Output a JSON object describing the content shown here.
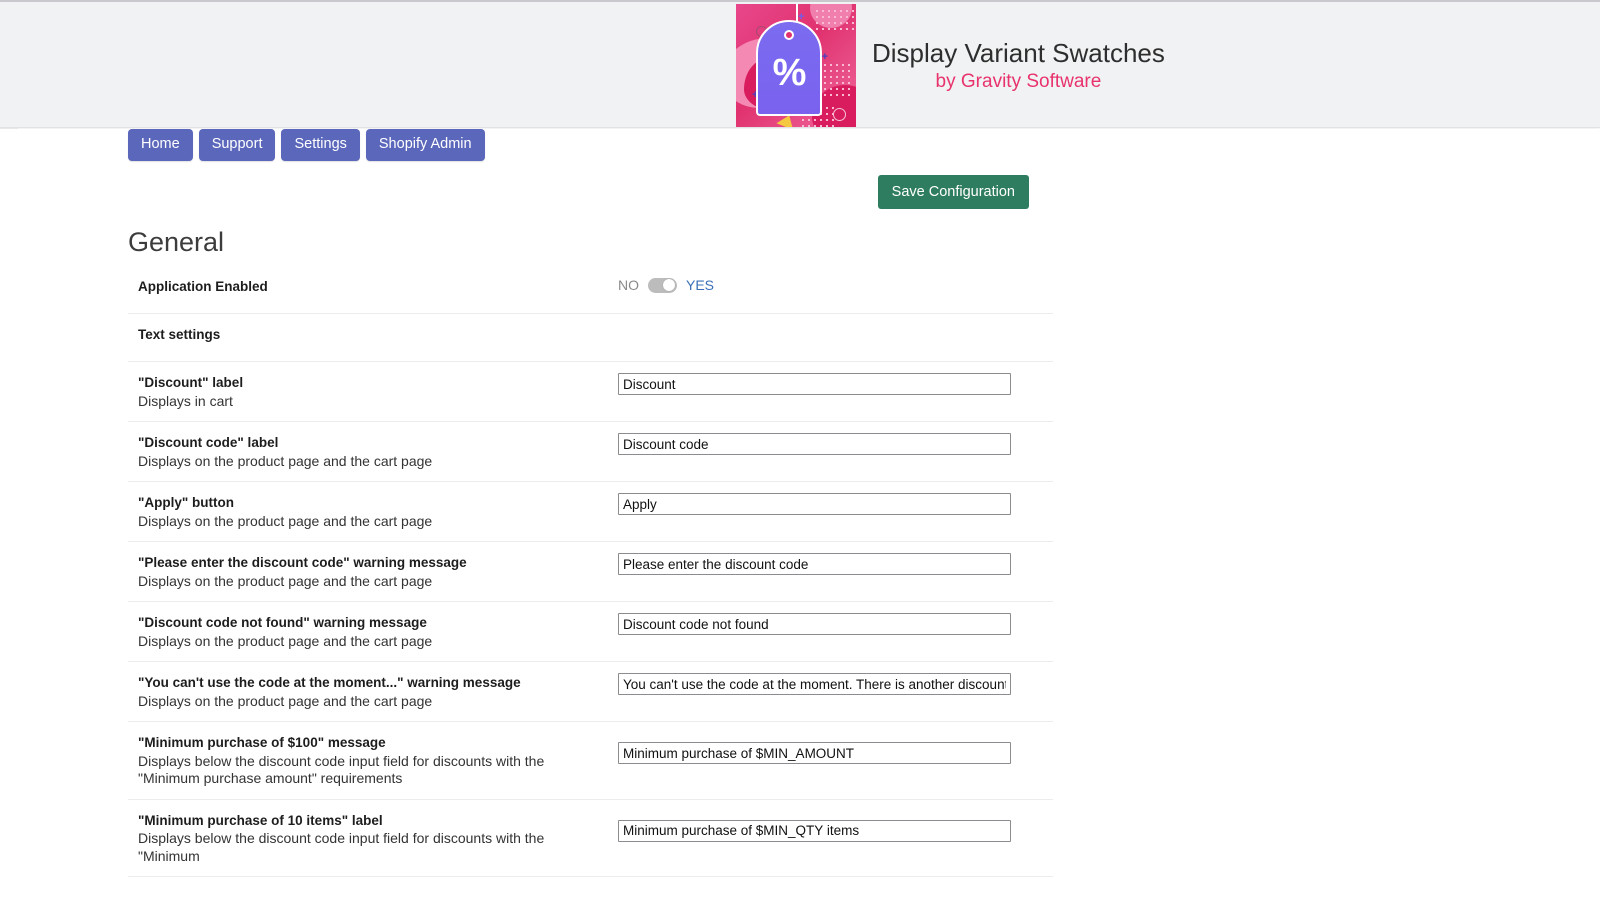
{
  "banner": {
    "app_title": "Display Variant Swatches",
    "byline": "by Gravity Software",
    "icon_name": "percent-tag-icon",
    "percent_symbol": "%",
    "accent_pink": "#e8336d",
    "background": "#f1f2f3"
  },
  "nav": {
    "items": [
      {
        "label": "Home",
        "name": "nav-home"
      },
      {
        "label": "Support",
        "name": "nav-support"
      },
      {
        "label": "Settings",
        "name": "nav-settings"
      },
      {
        "label": "Shopify Admin",
        "name": "nav-shopify-admin"
      }
    ],
    "color": "#5a67bb"
  },
  "toolbar": {
    "save_label": "Save Configuration",
    "save_color": "#2e7d61"
  },
  "main": {
    "section_title": "General",
    "rows": [
      {
        "title": "Application Enabled",
        "desc": "",
        "control": "toggle",
        "toggle_off": "NO",
        "toggle_on": "YES",
        "toggle_state": "on"
      },
      {
        "title": "Text settings",
        "desc": "",
        "control": "none"
      },
      {
        "title": "\"Discount\" label",
        "desc": "Displays in cart",
        "control": "input",
        "value": "Discount"
      },
      {
        "title": "\"Discount code\" label",
        "desc": "Displays on the product page and the cart page",
        "control": "input",
        "value": "Discount code"
      },
      {
        "title": "\"Apply\" button",
        "desc": "Displays on the product page and the cart page",
        "control": "input",
        "value": "Apply"
      },
      {
        "title": "\"Please enter the discount code\" warning message",
        "desc": "Displays on the product page and the cart page",
        "control": "input",
        "value": "Please enter the discount code"
      },
      {
        "title": "\"Discount code not found\" warning message",
        "desc": "Displays on the product page and the cart page",
        "control": "input",
        "value": "Discount code not found"
      },
      {
        "title": "\"You can't use the code at the moment...\" warning message",
        "desc": "Displays on the product page and the cart page",
        "control": "input",
        "value": "You can't use the code at the moment. There is another discount"
      },
      {
        "title": "\"Minimum purchase of $100\" message",
        "desc": "Displays below the discount code input field for discounts with the \"Minimum purchase amount\" requirements",
        "control": "input",
        "value": "Minimum purchase of $MIN_AMOUNT"
      },
      {
        "title": "\"Minimum purchase of 10 items\" label",
        "desc": "Displays below the discount code input field for discounts with the \"Minimum",
        "control": "input",
        "value": "Minimum purchase of $MIN_QTY items"
      }
    ]
  }
}
